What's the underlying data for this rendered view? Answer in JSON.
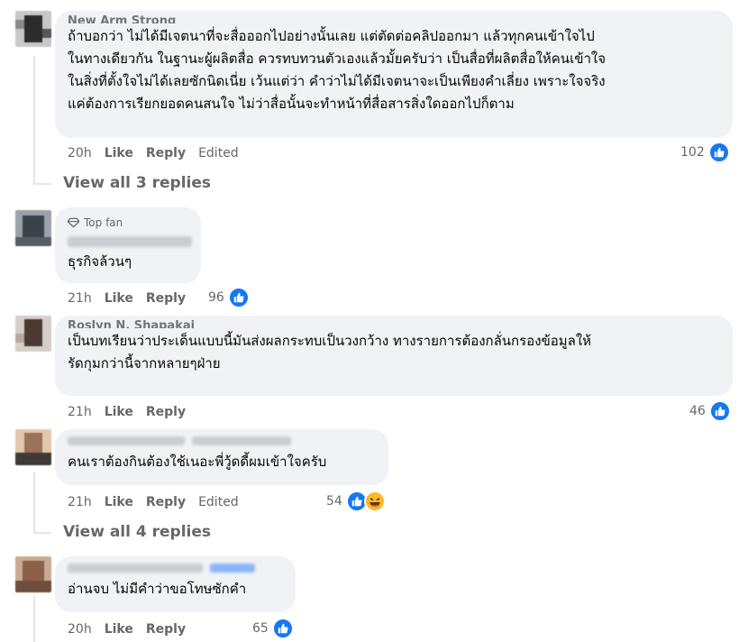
{
  "comments": [
    {
      "author": "New Arm Strong",
      "lines": [
        "ถ้าบอกว่า ไม่ได้มีเจตนาที่จะสื่อออกไปอย่างนั้นเลย แต่ตัดต่อคลิปออกมา แล้วทุกคนเข้าใจไป",
        "ในทางเดียวกัน ในฐานะผู้ผลิตสื่อ ควรทบทวนตัวเองแล้วมั้ยครับว่า เป็นสื่อที่ผลิตสื่อให้คนเข้าใจ",
        "ในสิ่งที่ตั้งใจไม่ได้เลยซักนิดเนี่ย เว้นแต่ว่า คำว่าไม่ได้มีเจตนาจะเป็นเพียงคำเลี่ยง เพราะใจจริง",
        "แค่ต้องการเรียกยอดคนสนใจ ไม่ว่าสื่อนั้นจะทำหน้าที่สื่อสารสิ่งใดออกไปก็ตาม"
      ],
      "time": "20h",
      "like": "Like",
      "reply": "Reply",
      "edited": "Edited",
      "reactions": "102",
      "view_replies": "View all 3 replies"
    },
    {
      "badge": "Top fan",
      "lines": [
        "ธุรกิจล้วนๆ"
      ],
      "time": "21h",
      "like": "Like",
      "reply": "Reply",
      "reactions": "96"
    },
    {
      "author": "Roslyn N. Shapakai",
      "lines": [
        "เป็นบทเรียนว่าประเด็นแบบนี้มันส่งผลกระทบเป็นวงกว้าง ทางรายการต้องกลั่นกรองข้อมูลให้",
        "รัดกุมกว่านี้จากหลายๆฝ่าย"
      ],
      "time": "21h",
      "like": "Like",
      "reply": "Reply",
      "reactions": "46"
    },
    {
      "lines": [
        "คนเราต้องกินต้องใช้เนอะพี่วู้ดดี้ผมเข้าใจครับ"
      ],
      "time": "21h",
      "like": "Like",
      "reply": "Reply",
      "edited": "Edited",
      "reactions": "54",
      "view_replies": "View all 4 replies"
    },
    {
      "lines": [
        "อ่านจบ ไม่มีคำว่าขอโทษซักคำ"
      ],
      "time": "20h",
      "like": "Like",
      "reply": "Reply",
      "reactions": "65"
    }
  ],
  "colors": {
    "like_blue": "#1877f2",
    "haha_yellow": "#f7b928",
    "bubble": "#f0f2f5",
    "secondary": "#65676b"
  }
}
